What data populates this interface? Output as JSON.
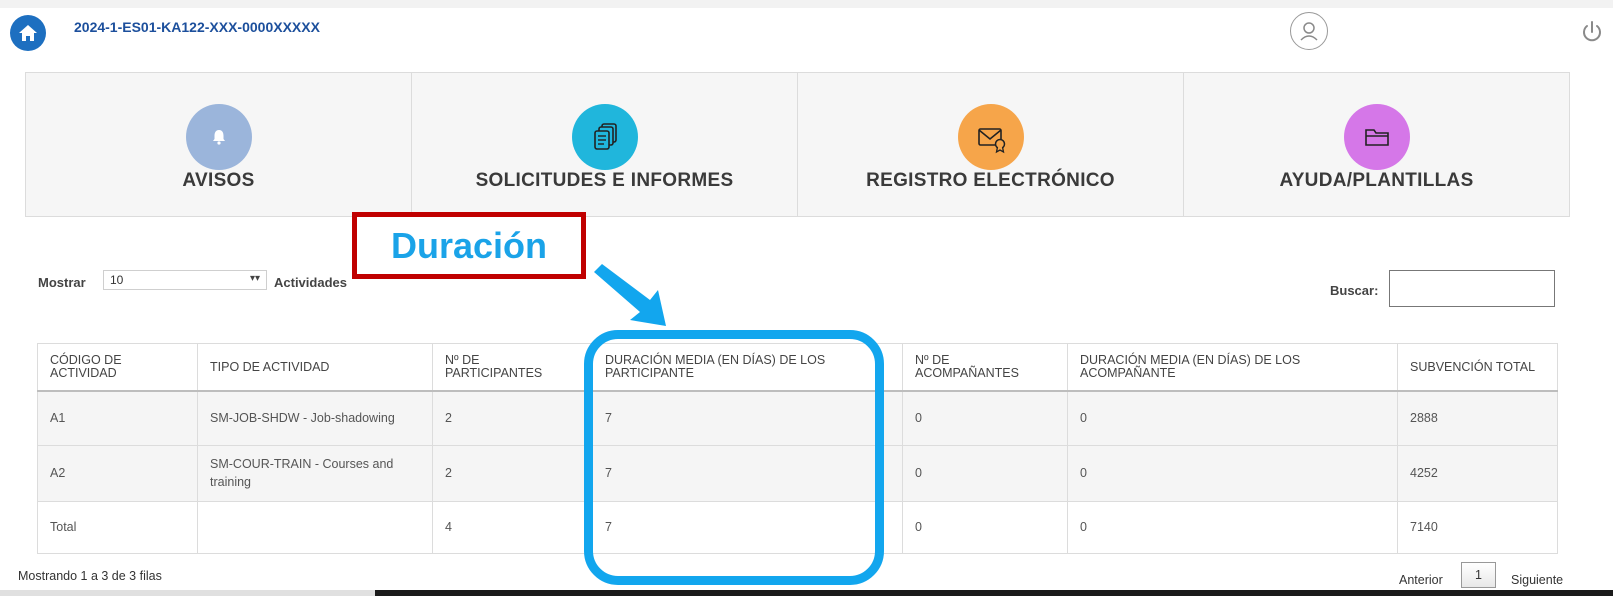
{
  "header": {
    "project_code": "2024-1-ES01-KA122-XXX-0000XXXXX",
    "home_icon": "home-icon",
    "user_icon": "user-icon",
    "power_icon": "power-icon"
  },
  "menu": [
    {
      "label": "AVISOS",
      "icon": "bell-icon",
      "color": "#9bb5db"
    },
    {
      "label": "SOLICITUDES E INFORMES",
      "icon": "documents-icon",
      "color": "#20b6dc"
    },
    {
      "label": "REGISTRO ELECTRÓNICO",
      "icon": "envelope-certificate-icon",
      "color": "#f6a54a"
    },
    {
      "label": "AYUDA/PLANTILLAS",
      "icon": "folder-icon",
      "color": "#d577e8"
    }
  ],
  "annotation": {
    "label": "Duración",
    "box_color": "#c00000",
    "text_color": "#1aa3e8",
    "highlight_color": "#12a6ee"
  },
  "controls": {
    "show_label": "Mostrar",
    "show_value": "10",
    "show_after": "Actividades",
    "search_label": "Buscar:",
    "search_value": ""
  },
  "table": {
    "headers": [
      "CÓDIGO DE ACTIVIDAD",
      "TIPO DE ACTIVIDAD",
      "Nº DE PARTICIPANTES",
      "DURACIÓN MEDIA (EN DÍAS) DE LOS PARTICIPANTE",
      "Nº DE ACOMPAÑANTES",
      "DURACIÓN MEDIA (EN DÍAS) DE LOS ACOMPAÑANTE",
      "SUBVENCIÓN TOTAL"
    ],
    "rows": [
      [
        "A1",
        "SM-JOB-SHDW - Job-shadowing",
        "2",
        "7",
        "0",
        "0",
        "2888"
      ],
      [
        "A2",
        "SM-COUR-TRAIN - Courses and training",
        "2",
        "7",
        "0",
        "0",
        "4252"
      ],
      [
        "Total",
        "",
        "4",
        "7",
        "0",
        "0",
        "7140"
      ]
    ]
  },
  "footer": {
    "info": "Mostrando 1 a 3 de 3 filas",
    "prev": "Anterior",
    "page": "1",
    "next": "Siguiente"
  }
}
